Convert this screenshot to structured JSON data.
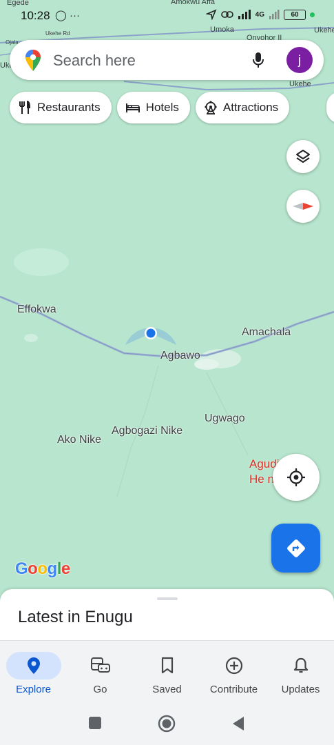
{
  "status_bar": {
    "time": "10:28",
    "left_icons": "◯ ···",
    "network": "4G",
    "battery": "60"
  },
  "search": {
    "placeholder": "Search here",
    "avatar_initial": "j"
  },
  "chips": [
    {
      "label": "Restaurants",
      "icon": "fork-knife-icon"
    },
    {
      "label": "Hotels",
      "icon": "bed-icon"
    },
    {
      "label": "Attractions",
      "icon": "ferris-wheel-icon"
    }
  ],
  "map": {
    "places": [
      {
        "name": "Effokwa"
      },
      {
        "name": "Amachala"
      },
      {
        "name": "Agbawo"
      },
      {
        "name": "Ugwago"
      },
      {
        "name": "Agbogazi Nike"
      },
      {
        "name": "Ako Nike"
      }
    ],
    "small_places": [
      {
        "name": "Egede"
      },
      {
        "name": "Amokwu Affa"
      },
      {
        "name": "Umoka"
      },
      {
        "name": "Onyohor II"
      },
      {
        "name": "Ukehe"
      },
      {
        "name": "Ukehe"
      },
      {
        "name": "Ojala"
      },
      {
        "name": "Ukehe Rd"
      },
      {
        "name": "Uke"
      }
    ],
    "poi_red": {
      "line1": "Agudi  Neke",
      "line2": "He       ntre"
    },
    "logo": "Google"
  },
  "sheet": {
    "title": "Latest in Enugu"
  },
  "bottom_nav": [
    {
      "label": "Explore",
      "icon": "explore-pin-icon",
      "active": true
    },
    {
      "label": "Go",
      "icon": "car-bus-icon",
      "active": false
    },
    {
      "label": "Saved",
      "icon": "bookmark-icon",
      "active": false
    },
    {
      "label": "Contribute",
      "icon": "add-circle-icon",
      "active": false
    },
    {
      "label": "Updates",
      "icon": "bell-icon",
      "active": false
    }
  ],
  "colors": {
    "map_green": "#b7e5cd",
    "accent_blue": "#1a73e8",
    "avatar_purple": "#7b1fa2",
    "poi_red": "#d93025"
  }
}
